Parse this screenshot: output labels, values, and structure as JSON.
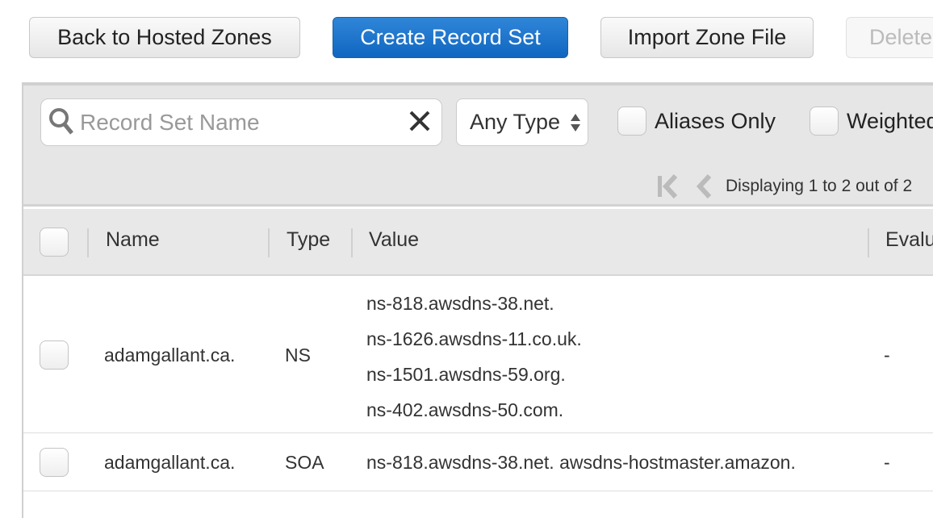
{
  "toolbar": {
    "back": "Back to Hosted Zones",
    "create": "Create Record Set",
    "import": "Import Zone File",
    "delete": "Delete"
  },
  "filter": {
    "search_placeholder": "Record Set Name",
    "type_select": "Any Type",
    "aliases_only": "Aliases Only",
    "weighted": "Weighted"
  },
  "pager": {
    "status": "Displaying 1 to 2 out of 2"
  },
  "table": {
    "columns": [
      "Name",
      "Type",
      "Value",
      "Evalu"
    ],
    "rows": [
      {
        "name": "adamgallant.ca.",
        "type": "NS",
        "values": [
          "ns-818.awsdns-38.net.",
          "ns-1626.awsdns-11.co.uk.",
          "ns-1501.awsdns-59.org.",
          "ns-402.awsdns-50.com."
        ],
        "evaluate": "-"
      },
      {
        "name": "adamgallant.ca.",
        "type": "SOA",
        "values": [
          "ns-818.awsdns-38.net. awsdns-hostmaster.amazon."
        ],
        "evaluate": "-"
      }
    ]
  }
}
